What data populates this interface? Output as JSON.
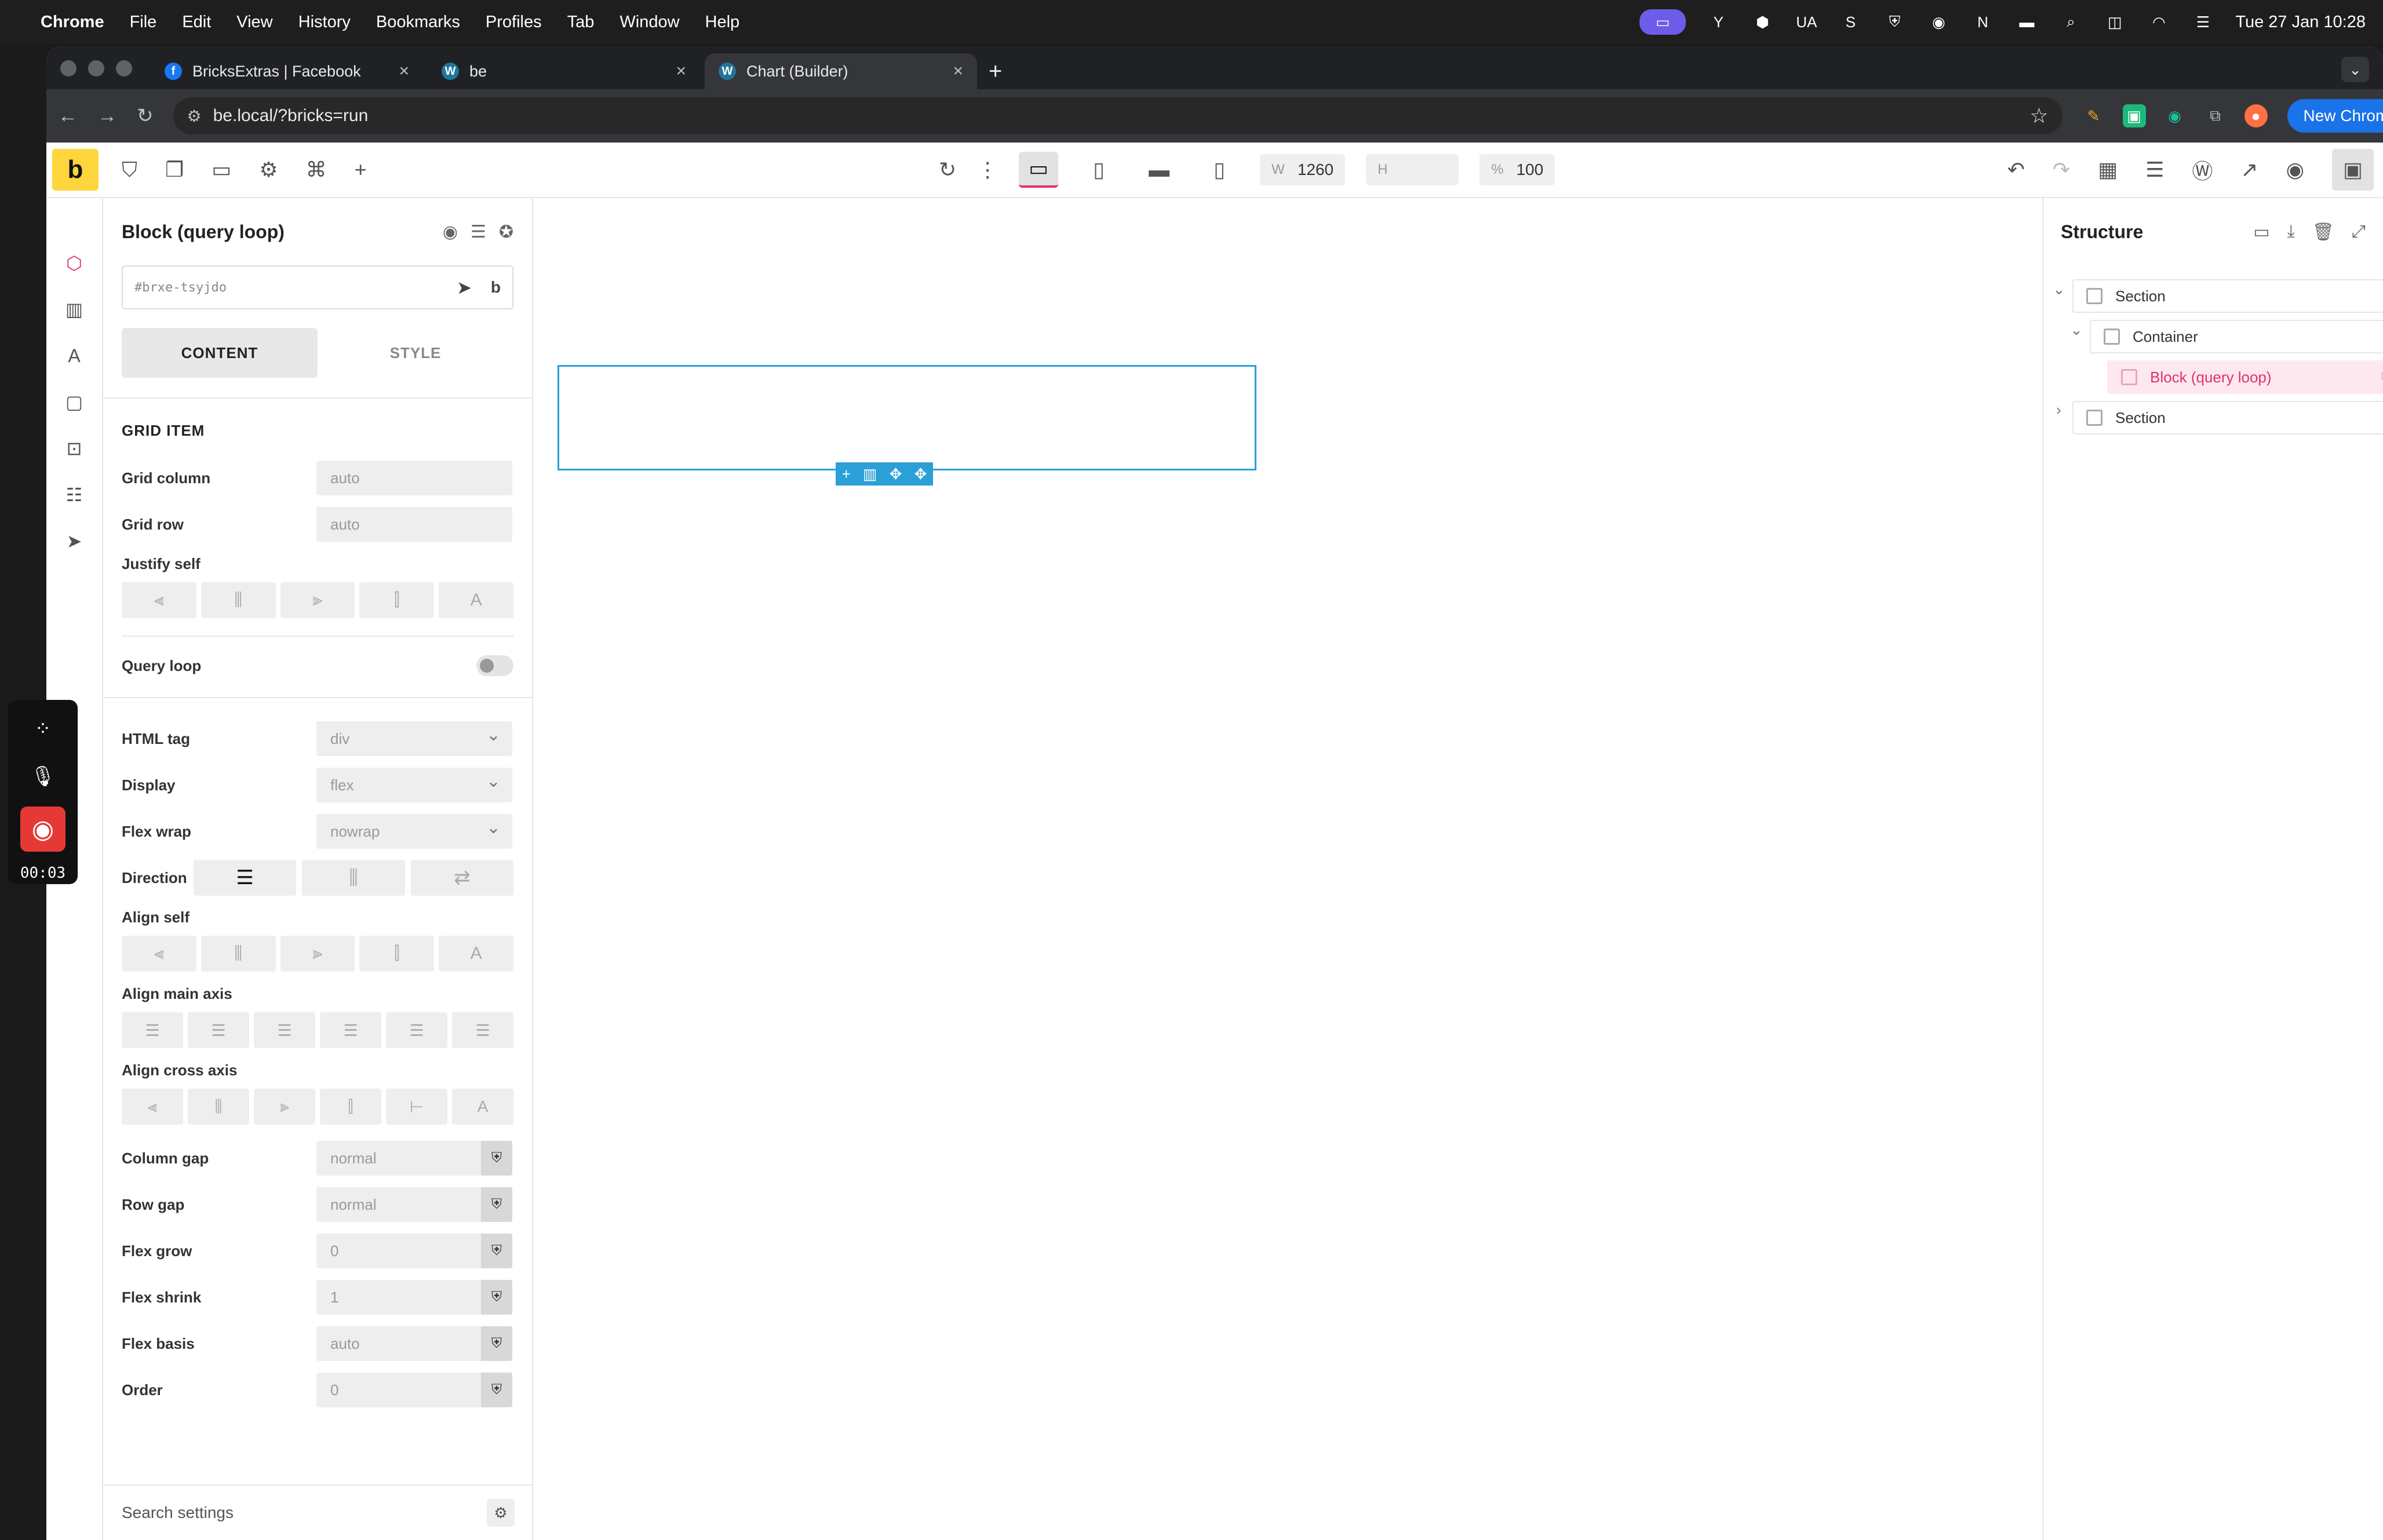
{
  "menubar": {
    "app": "Chrome",
    "items": [
      "File",
      "Edit",
      "View",
      "History",
      "Bookmarks",
      "Profiles",
      "Tab",
      "Window",
      "Help"
    ],
    "input_source": "UA",
    "clock": "Tue 27 Jan  10:28"
  },
  "browser": {
    "tabs": [
      {
        "title": "BricksExtras | Facebook"
      },
      {
        "title": "be"
      },
      {
        "title": "Chart (Builder)"
      }
    ],
    "url": "be.local/?bricks=run",
    "new_chrome_label": "New Chrome available"
  },
  "builder": {
    "width_label": "W",
    "width_value": "1260",
    "height_label": "H",
    "height_value": "",
    "zoom_label": "%",
    "zoom_value": "100"
  },
  "panel": {
    "title": "Block (query loop)",
    "element_id": "#brxe-tsyjdo",
    "tabs": [
      "CONTENT",
      "STYLE"
    ],
    "section_grid_item": "GRID ITEM",
    "grid_column_label": "Grid column",
    "grid_column_value": "auto",
    "grid_row_label": "Grid row",
    "grid_row_value": "auto",
    "justify_self_label": "Justify self",
    "query_loop_label": "Query loop",
    "html_tag_label": "HTML tag",
    "html_tag_value": "div",
    "display_label": "Display",
    "display_value": "flex",
    "flex_wrap_label": "Flex wrap",
    "flex_wrap_value": "nowrap",
    "direction_label": "Direction",
    "align_self_label": "Align self",
    "align_main_label": "Align main axis",
    "align_cross_label": "Align cross axis",
    "column_gap_label": "Column gap",
    "column_gap_value": "normal",
    "row_gap_label": "Row gap",
    "row_gap_value": "normal",
    "flex_grow_label": "Flex grow",
    "flex_grow_value": "0",
    "flex_shrink_label": "Flex shrink",
    "flex_shrink_value": "1",
    "flex_basis_label": "Flex basis",
    "flex_basis_value": "auto",
    "order_label": "Order",
    "order_value": "0",
    "search_placeholder": "Search settings"
  },
  "structure": {
    "title": "Structure",
    "nodes": [
      "Section",
      "Container",
      "Block (query loop)",
      "Section"
    ]
  },
  "recorder": {
    "time": "00:03"
  },
  "colors": {
    "accent": "#e0326e",
    "bricks_yellow": "#ffd53e",
    "selection_blue": "#2a9fd8",
    "chrome_blue": "#1a73e8"
  }
}
